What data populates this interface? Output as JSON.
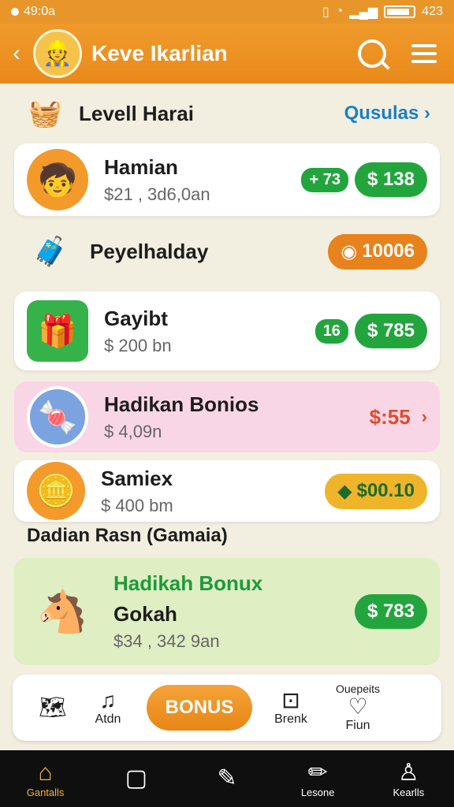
{
  "status": {
    "time": "49:0a",
    "clock": "423"
  },
  "header": {
    "title": "Keve Ikarlian"
  },
  "level": {
    "title": "Levell Harai",
    "link": "Qusulas"
  },
  "items": [
    {
      "name": "Hamian",
      "sub": "$21 , 3d6,0an",
      "badge": "+ 73",
      "price": "$ 138"
    },
    {
      "name": "Peyelhalday",
      "price": "10006"
    },
    {
      "name": "Gayibt",
      "sub": "$ 200 bn",
      "badge": "16",
      "price": "$ 785"
    },
    {
      "name": "Hadikan Bonios",
      "sub": "$ 4,09n",
      "price": "$:55"
    },
    {
      "name": "Samiex",
      "sub": "$ 400 bm",
      "price": "$00.10"
    }
  ],
  "section_label": "Dadian Rasn (Gamaia)",
  "featured": {
    "title": "Hadikah Bonux",
    "name": "Gokah",
    "sub": "$34 , 342 9an",
    "price": "$ 783"
  },
  "bottom_panel": {
    "item1": "Atdn",
    "bonus": "BONUS",
    "item3": "Brenk",
    "item4_top": "Ouepeits",
    "item4": "Fiun"
  },
  "nav": [
    "Gantalls",
    "",
    "",
    "Lesone",
    "Kearlls"
  ],
  "colors": {
    "orange": "#e8962a",
    "green": "#23a53e",
    "blue": "#1c7fc6"
  }
}
